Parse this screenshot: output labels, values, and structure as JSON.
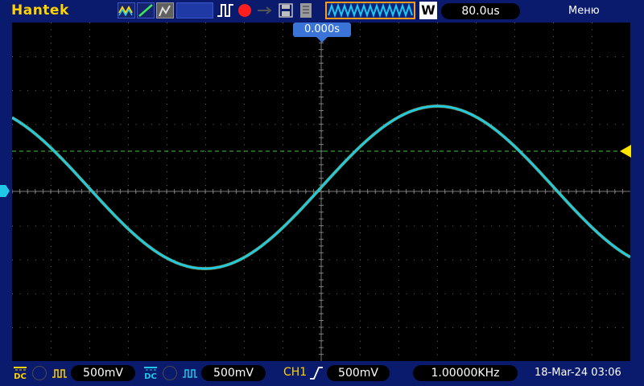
{
  "brand": "Hantek",
  "timebase": "80.0us",
  "menu_label": "Меню",
  "trigger_position": "0.000s",
  "bottom": {
    "ch1_coupling": "DC",
    "ch1_volts": "500mV",
    "ch2_coupling": "DC",
    "ch2_volts": "500mV",
    "trigger_source": "CH1",
    "trigger_level": "500mV",
    "frequency": "1.00000KHz",
    "datetime": "18-Mar-24 03:06"
  },
  "mode_icon": "W",
  "colors": {
    "ch1": "#ffd200",
    "ch2": "#1ec8e6",
    "trigger": "#ffe600",
    "grid": "#6a6a6a",
    "background": "#0a1a6c"
  },
  "icons": [
    "wave-mode-icon",
    "line-mode-icon",
    "persistence-icon",
    "trigger-edge-icon",
    "record-icon",
    "arrow-icon",
    "save-icon",
    "copy-icon",
    "memory-depth-icon"
  ]
}
